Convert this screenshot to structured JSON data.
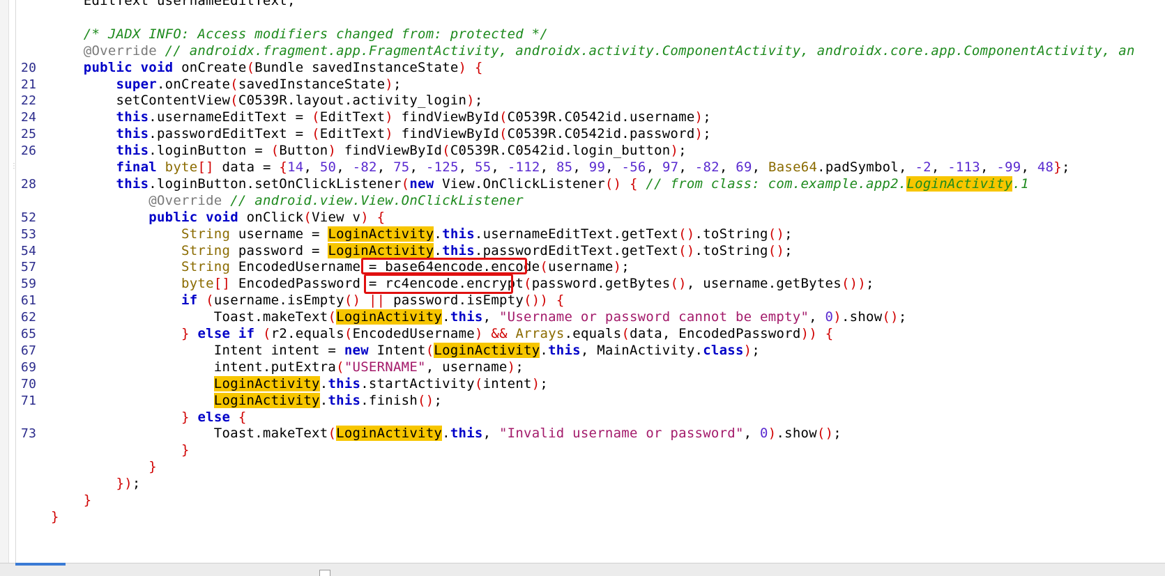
{
  "editor": {
    "lines": [
      {
        "n": "",
        "code": "    EditText usernameEditText;"
      },
      {
        "n": "",
        "code": ""
      },
      {
        "n": "",
        "code": "    /* JADX INFO: Access modifiers changed from: protected */"
      },
      {
        "n": "",
        "code": "    @Override // androidx.fragment.app.FragmentActivity, androidx.activity.ComponentActivity, androidx.core.app.ComponentActivity, an"
      },
      {
        "n": "20",
        "code": "    public void onCreate(Bundle savedInstanceState) {"
      },
      {
        "n": "21",
        "code": "        super.onCreate(savedInstanceState);"
      },
      {
        "n": "22",
        "code": "        setContentView(C0539R.layout.activity_login);"
      },
      {
        "n": "24",
        "code": "        this.usernameEditText = (EditText) findViewById(C0539R.C0542id.username);"
      },
      {
        "n": "25",
        "code": "        this.passwordEditText = (EditText) findViewById(C0539R.C0542id.password);"
      },
      {
        "n": "26",
        "code": "        this.loginButton = (Button) findViewById(C0539R.C0542id.login_button);"
      },
      {
        "n": "",
        "code": "        final byte[] data = {14, 50, -82, 75, -125, 55, -112, 85, 99, -56, 97, -82, 69, Base64.padSymbol, -2, -113, -99, 48};"
      },
      {
        "n": "28",
        "code": "        this.loginButton.setOnClickListener(new View.OnClickListener() { // from class: com.example.app2.LoginActivity.1"
      },
      {
        "n": "",
        "code": "            @Override // android.view.View.OnClickListener"
      },
      {
        "n": "52",
        "code": "            public void onClick(View v) {"
      },
      {
        "n": "53",
        "code": "                String username = LoginActivity.this.usernameEditText.getText().toString();"
      },
      {
        "n": "54",
        "code": "                String password = LoginActivity.this.passwordEditText.getText().toString();"
      },
      {
        "n": "57",
        "code": "                String EncodedUsername = base64encode.encode(username);"
      },
      {
        "n": "59",
        "code": "                byte[] EncodedPassword = rc4encode.encrypt(password.getBytes(), username.getBytes());"
      },
      {
        "n": "61",
        "code": "                if (username.isEmpty() || password.isEmpty()) {"
      },
      {
        "n": "62",
        "code": "                    Toast.makeText(LoginActivity.this, \"Username or password cannot be empty\", 0).show();"
      },
      {
        "n": "65",
        "code": "                } else if (r2.equals(EncodedUsername) && Arrays.equals(data, EncodedPassword)) {"
      },
      {
        "n": "67",
        "code": "                    Intent intent = new Intent(LoginActivity.this, MainActivity.class);"
      },
      {
        "n": "69",
        "code": "                    intent.putExtra(\"USERNAME\", username);"
      },
      {
        "n": "70",
        "code": "                    LoginActivity.this.startActivity(intent);"
      },
      {
        "n": "71",
        "code": "                    LoginActivity.this.finish();"
      },
      {
        "n": "",
        "code": "                } else {"
      },
      {
        "n": "73",
        "code": "                    Toast.makeText(LoginActivity.this, \"Invalid username or password\", 0).show();"
      },
      {
        "n": "",
        "code": "                }"
      },
      {
        "n": "",
        "code": "            }"
      },
      {
        "n": "",
        "code": "        });"
      },
      {
        "n": "",
        "code": "    }"
      },
      {
        "n": "",
        "code": "}"
      }
    ],
    "highlight_word": "LoginActivity",
    "annotations": [
      "base64encode.encode(",
      "rc4encode.encrypt("
    ]
  },
  "colors": {
    "keyword": "#0000c8",
    "comment": "#1d8a1d",
    "string": "#a31a6a",
    "number": "#5a2bd0",
    "highlight": "#f7c600",
    "annotation_box": "#e01010"
  }
}
